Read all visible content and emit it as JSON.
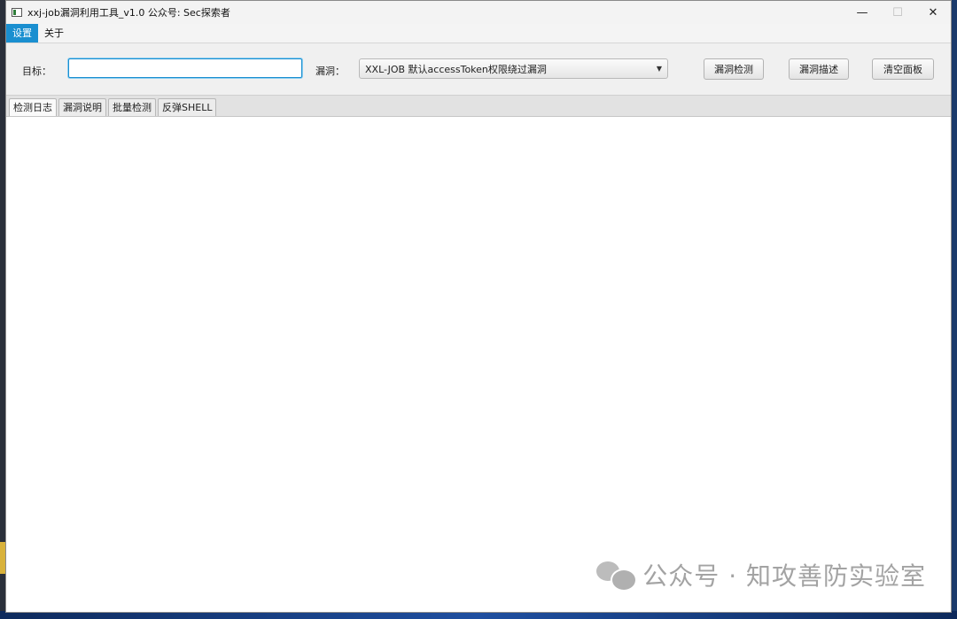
{
  "window": {
    "title": "xxj-job漏洞利用工具_v1.0  公众号: Sec探索者",
    "controls": {
      "minimize": "—",
      "maximize": "☐",
      "close": "✕"
    }
  },
  "menu": {
    "settings": "设置",
    "about": "关于"
  },
  "toolbar": {
    "target_label": "目标：",
    "target_value": "",
    "vuln_label": "漏洞：",
    "vuln_selected": "XXL-JOB 默认accessToken权限绕过漏洞",
    "check_button": "漏洞检测",
    "describe_button": "漏洞描述",
    "clear_button": "清空面板"
  },
  "tabs": [
    "检测日志",
    "漏洞说明",
    "批量检测",
    "反弹SHELL"
  ],
  "watermark": "公众号 · 知攻善防实验室",
  "colors": {
    "accent": "#1a8fd0",
    "window_bg": "#f0f0f0"
  }
}
